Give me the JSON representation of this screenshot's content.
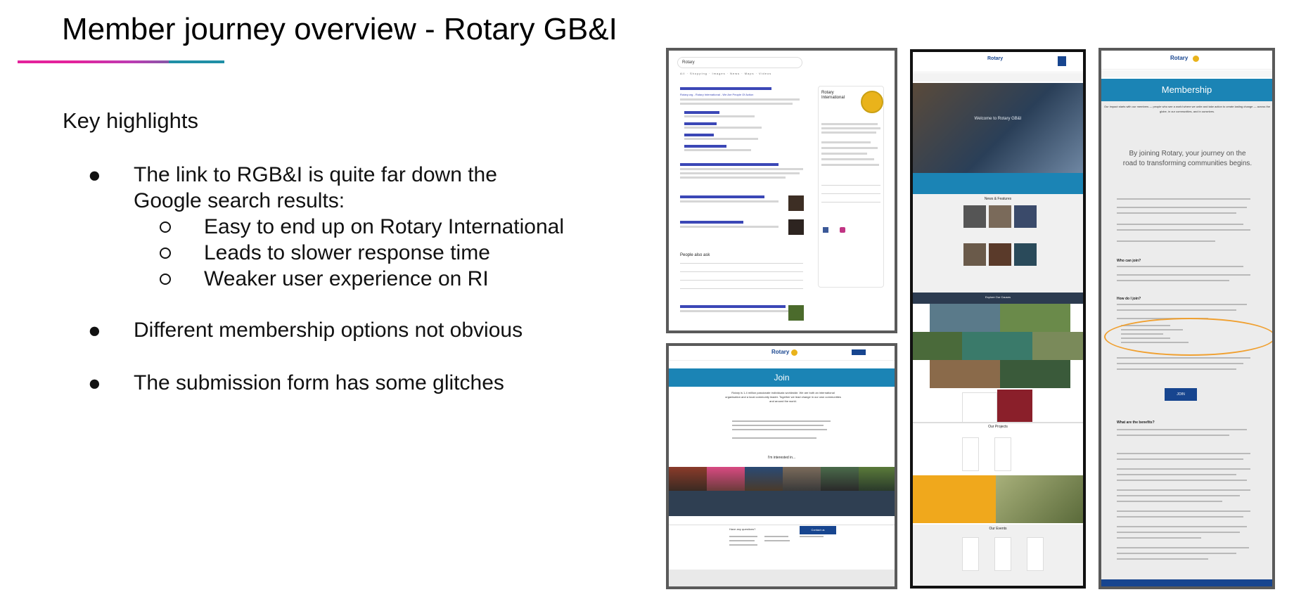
{
  "slide": {
    "title": "Member journey overview - Rotary GB&I",
    "accent_colors": [
      "#e3229b",
      "#1f8fa6"
    ],
    "subheading": "Key highlights",
    "bullets": [
      {
        "text_line1": "The link to RGB&I is quite far down the",
        "text_line2": "Google search results:",
        "subitems": [
          "Easy to end up on Rotary International",
          "Leads to slower response time",
          "Weaker user experience on RI"
        ]
      },
      {
        "text": "Different membership options not obvious"
      },
      {
        "text": "The submission form has some glitches"
      }
    ]
  },
  "screenshots": {
    "google": {
      "query": "Rotary",
      "panel_title": "Rotary International",
      "result_heading": "Rotary.org - Rotary International - We Are People Of Action",
      "people_also_ask": "People also ask"
    },
    "join": {
      "logo": "Rotary",
      "band_title": "Join",
      "headline": "Rotary is 1.4 million passionate individuals worldwide. We are both an international organisation and a local community leader. Together we lead change in our own communities and around the world.",
      "section": "I'm interested in...",
      "cta": "Contact us",
      "footer_heading": "Have any questions?"
    },
    "home": {
      "logo": "Rotary",
      "hero_text": "Welcome to Rotary GB&I",
      "news_heading": "News & Features",
      "causes_heading": "Explore Our Causes",
      "projects_heading": "Our Projects",
      "events_heading": "Our Events"
    },
    "membership": {
      "logo": "Rotary",
      "band_title": "Membership",
      "intro": "Our impact starts with our members — people who see a world where we unite and take action to create lasting change — across the globe, in our communities, and in ourselves.",
      "headline": "By joining Rotary, your journey on the road to transforming communities begins.",
      "who_heading": "Who can join?",
      "how_heading": "How do I join?",
      "join_button": "JOIN",
      "benefits_heading": "What are the benefits?",
      "highlight_color": "#f0a030"
    }
  }
}
